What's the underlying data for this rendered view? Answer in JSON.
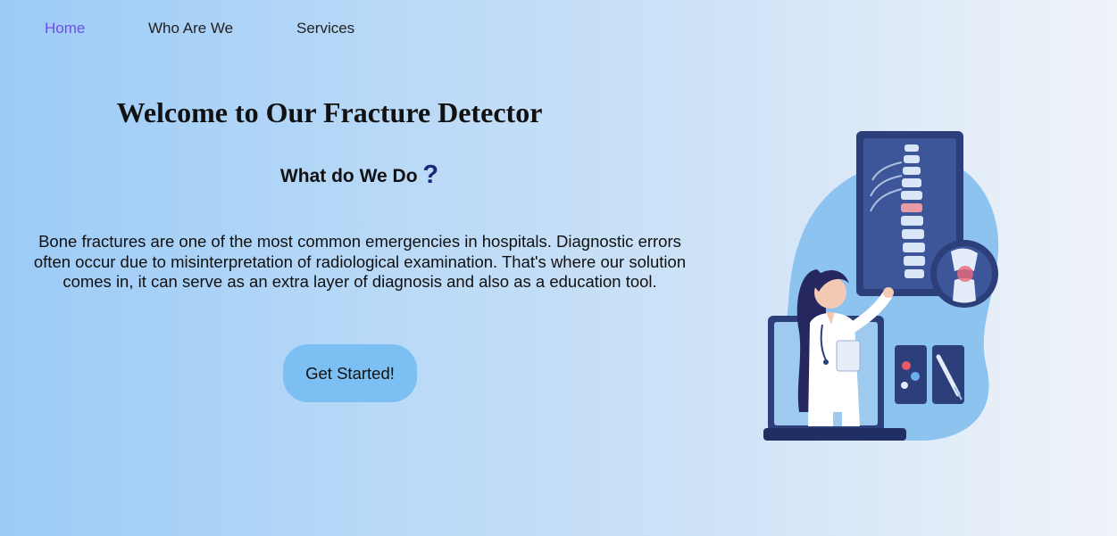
{
  "nav": {
    "items": [
      {
        "label": "Home",
        "active": true
      },
      {
        "label": "Who Are We",
        "active": false
      },
      {
        "label": "Services",
        "active": false
      }
    ]
  },
  "hero": {
    "title": "Welcome to Our Fracture Detector",
    "subtitle": "What do We Do",
    "subtitle_mark": "?",
    "description": "Bone fractures are one of the most common emergencies in hospitals. Diagnostic errors often occur due to misinterpretation of radiological examination. That's where our solution comes in, it can serve as an extra layer of diagnosis and also as a education tool.",
    "cta_label": "Get Started!"
  },
  "colors": {
    "nav_active": "#6f4de6",
    "button_bg": "#7bbff3",
    "text": "#111111"
  }
}
